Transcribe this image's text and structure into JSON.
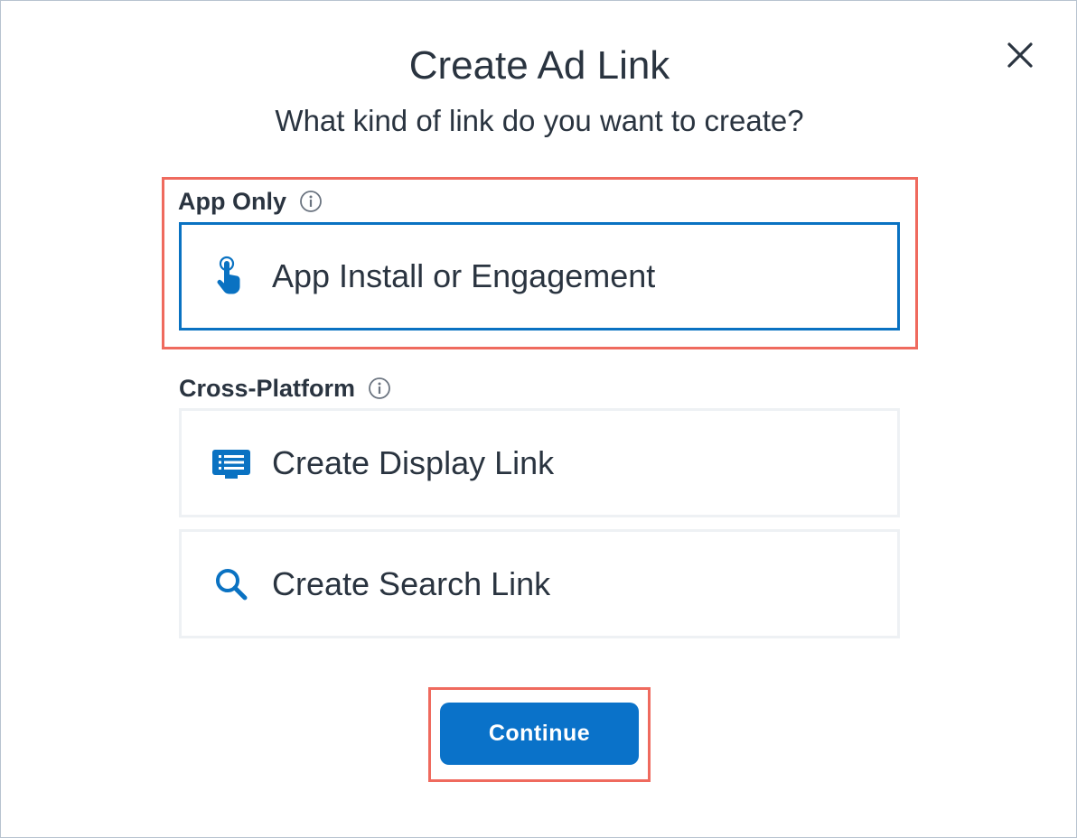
{
  "dialog": {
    "title": "Create Ad Link",
    "subtitle": "What kind of link do you want to create?",
    "close_icon": "close-icon"
  },
  "sections": {
    "app_only": {
      "label": "App Only",
      "info_icon": "info-icon",
      "options": [
        {
          "label": "App Install or Engagement",
          "icon": "tap-hand-icon",
          "selected": true
        }
      ]
    },
    "cross_platform": {
      "label": "Cross-Platform",
      "info_icon": "info-icon",
      "options": [
        {
          "label": "Create Display Link",
          "icon": "display-icon",
          "selected": false
        },
        {
          "label": "Create Search Link",
          "icon": "search-icon",
          "selected": false
        }
      ]
    }
  },
  "actions": {
    "continue_label": "Continue"
  },
  "colors": {
    "accent": "#0a72c2",
    "highlight": "#ef6a5e",
    "text": "#2a3440",
    "button": "#0a72c9"
  }
}
